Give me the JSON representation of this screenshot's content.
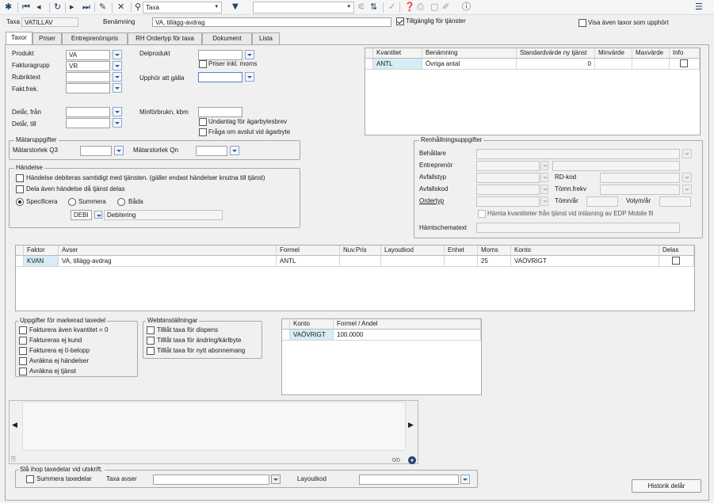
{
  "toolbar": {
    "search_value": "Taxa",
    "filter_value": "",
    "tillganglig_label": "Tillgänglig för tjänster",
    "tillganglig_checked": true,
    "visa_label": "Visa även taxor som upphört"
  },
  "header": {
    "taxa_label": "Taxa",
    "taxa_value": "VATILLAV",
    "benamning_label": "Benämning",
    "benamning_value": "VA, tillägg-avdrag"
  },
  "tabs": [
    "Taxor",
    "Priser",
    "Entreprenörspris",
    "RH Ordertyp för taxa",
    "Dokument",
    "Lista"
  ],
  "form": {
    "produkt_label": "Produkt",
    "produkt_value": "VA",
    "fakturagrupp_label": "Fakturagrupp",
    "fakturagrupp_value": "VR",
    "rubriktext_label": "Rubriktext",
    "rubriktext_value": "",
    "faktfrek_label": "Fakt.frek.",
    "faktfrek_value": "",
    "delprodukt_label": "Delprodukt",
    "delprodukt_value": "",
    "priser_moms_label": "Priser inkl. moms",
    "upphor_label": "Upphör att gälla",
    "upphor_value": "",
    "delar_fran_label": "Delår, från",
    "delar_till_label": "Delår, till",
    "minforbrukn_label": "Minförbrukn, kbm",
    "minforbrukn_value": "",
    "undantag_label": "Undantag för ägarbytesbrev",
    "fraga_label": "Fråga om avslut vid ägarbyte"
  },
  "matar": {
    "title": "Mätaruppgifter",
    "q3_label": "Mätarstorlek Q3",
    "qn_label": "Mätarstorlek Qn"
  },
  "handelse": {
    "title": "Händelse",
    "debiteras_label": "Händelse debiteras samtidigt med tjänsten. (gäller endast händelser knutna till tjänst)",
    "dela_label": "Dela även händelse då tjänst delas",
    "specificera_label": "Specificera",
    "summera_label": "Summera",
    "bada_label": "Båda",
    "code_value": "DEBI",
    "desc_value": "Debitering"
  },
  "kvantitet_grid": {
    "headers": [
      "Kvantitet",
      "Benämning",
      "Standardvärde ny tjänst",
      "Minvärde",
      "Maxvärde",
      "Info"
    ],
    "rows": [
      {
        "kvantitet": "ANTL",
        "benamning": "Övriga antal",
        "standard": "0",
        "min": "",
        "max": ""
      }
    ]
  },
  "renhallning": {
    "title": "Renhållningsuppgifter",
    "behallare_label": "Behållare",
    "entreprenor_label": "Entreprenör",
    "avfallstyp_label": "Avfallstyp",
    "rdkod_label": "RD-kod",
    "avfallskod_label": "Avfallskod",
    "tomnfrekv_label": "Tömn.frekv",
    "ordertyp_label": "Ordertyp",
    "tomnar_label": "Tömn/år",
    "volymar_label": "Volym/år",
    "hamta_label": "Hämta kvantiteter från tjänst vid inläsning av EDP Mobile fil",
    "hamtschema_label": "Hämtschematext"
  },
  "taxedel_grid": {
    "headers": [
      "Faktor",
      "Avser",
      "Formel",
      "Nuv.Pris",
      "Layoutkod",
      "Enhet",
      "Moms",
      "Konto",
      "Delas"
    ],
    "rows": [
      {
        "faktor": "KVAN",
        "avser": "VA, tillägg-avdrag",
        "formel": "ANTL",
        "nuvpris": "",
        "layoutkod": "",
        "enhet": "",
        "moms": "25",
        "konto": "VAÖVRIGT"
      }
    ]
  },
  "uppgifter": {
    "title": "Uppgifter för markerad taxedel",
    "items": [
      "Fakturera även kvantitet = 0",
      "Faktureras ej kund",
      "Fakturera ej 0-belopp",
      "Avräkna ej händelser",
      "Avräkna ej tjänst"
    ]
  },
  "webb": {
    "title": "Webbinställningar",
    "items": [
      "Tilllåt taxa för dispens",
      "Tilllåt taxa för ändring/kärlbyte",
      "Tilllåt taxa för nytt abonnemang"
    ]
  },
  "konto_grid": {
    "headers": [
      "Konto",
      "Formel / Andel"
    ],
    "rows": [
      {
        "konto": "VAÖVRIGT",
        "formel": "100.0000"
      }
    ]
  },
  "pager": {
    "count": "0/0"
  },
  "sla_ihop": {
    "title": "Slå ihop taxedelar vid utskrift.",
    "summera_label": "Summera taxedelar",
    "taxa_avser_label": "Taxa avser",
    "layoutkod_label": "Layoutkod"
  },
  "historik_button": "Historik delår"
}
